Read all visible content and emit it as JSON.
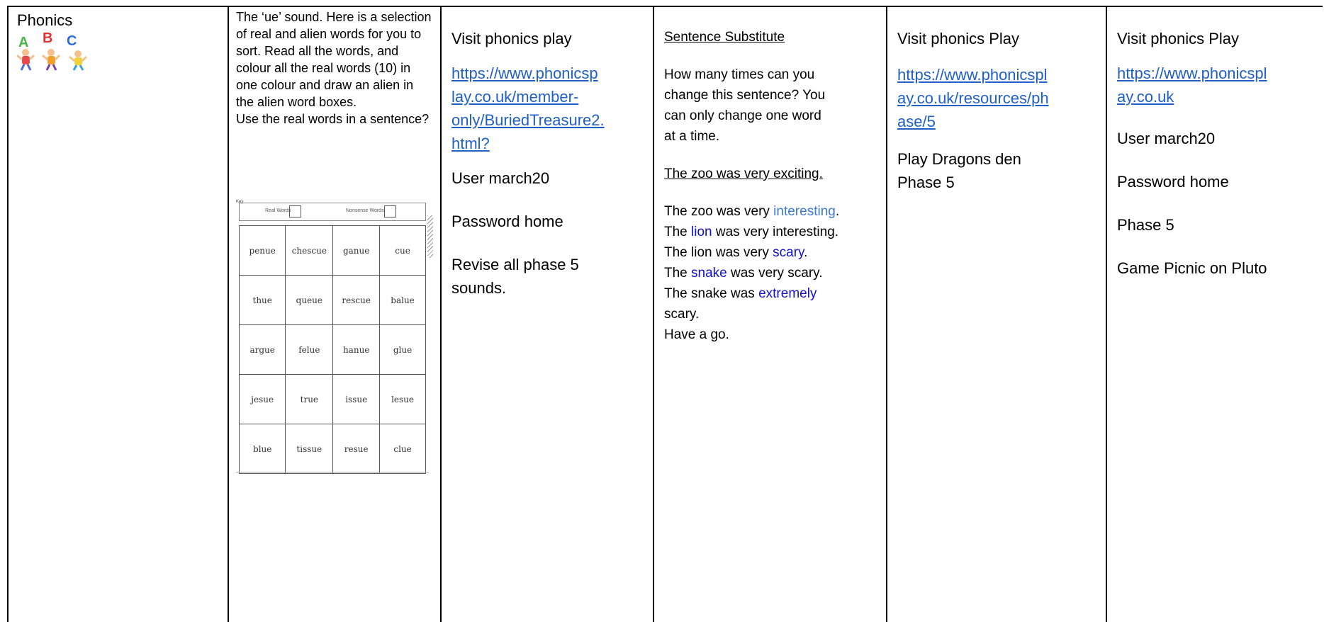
{
  "col1": {
    "title": "Phonics",
    "logo_letters": [
      "A",
      "B",
      "C"
    ]
  },
  "col2": {
    "intro": "The ‘ue’ sound. Here is a selection of real and alien words for you to sort. Read all the words, and colour all the real words (10) in one colour and draw an alien in the alien word boxes.",
    "instruction": "Use the real words in a sentence?",
    "worksheet": {
      "key_label": "Key",
      "real_label": "Real Words",
      "nonsense_label": "Nonsense Words",
      "rows": [
        [
          "penue",
          "chescue",
          "ganue",
          "cue"
        ],
        [
          "thue",
          "queue",
          "rescue",
          "balue"
        ],
        [
          "argue",
          "felue",
          "hanue",
          "glue"
        ],
        [
          "jesue",
          "true",
          "issue",
          "lesue"
        ],
        [
          "blue",
          "tissue",
          "resue",
          "clue"
        ]
      ]
    }
  },
  "col3": {
    "heading": "Visit phonics play",
    "link": "https://www.phonicsplay.co.uk/member-only/BuriedTreasure2.html?",
    "link_lines": [
      "https://www.phonicsp",
      "lay.co.uk/member-",
      "only/BuriedTreasure2.",
      "html?"
    ],
    "user": "User march20",
    "password": "Password home",
    "revise": "Revise all phase 5 sounds."
  },
  "col4": {
    "heading": "Sentence Substitute",
    "prompt": "How many times can you change this sentence? You can only change one word at a time.",
    "sentence": "The zoo was very exciting.",
    "lines": [
      [
        "The zoo was very ",
        "interesting",
        "."
      ],
      [
        "The ",
        "lion",
        " was very interesting."
      ],
      [
        "The lion was very ",
        "scary",
        "."
      ],
      [
        "The ",
        "snake",
        " was very scary."
      ],
      [
        "The snake was ",
        "extremely",
        " scary."
      ]
    ],
    "closing": "Have a go."
  },
  "col5": {
    "heading": "Visit phonics Play",
    "link": "https://www.phonicsplay.co.uk/resources/phase/5",
    "link_lines": [
      "https://www.phonicspl",
      "ay.co.uk/resources/ph",
      "ase/5"
    ],
    "activity": "Play Dragons den Phase 5"
  },
  "col6": {
    "heading": "Visit phonics Play",
    "link": "https://www.phonicsplay.co.uk",
    "link_lines": [
      "https://www.phonicspl",
      "ay.co.uk"
    ],
    "user": "User march20",
    "password": "Password home",
    "phase": "Phase 5",
    "game": "Game Picnic on Pluto"
  },
  "colors": {
    "link": "#1f5fc6",
    "highlight": "#1010c8",
    "highlight_light": "#3b79d6"
  }
}
